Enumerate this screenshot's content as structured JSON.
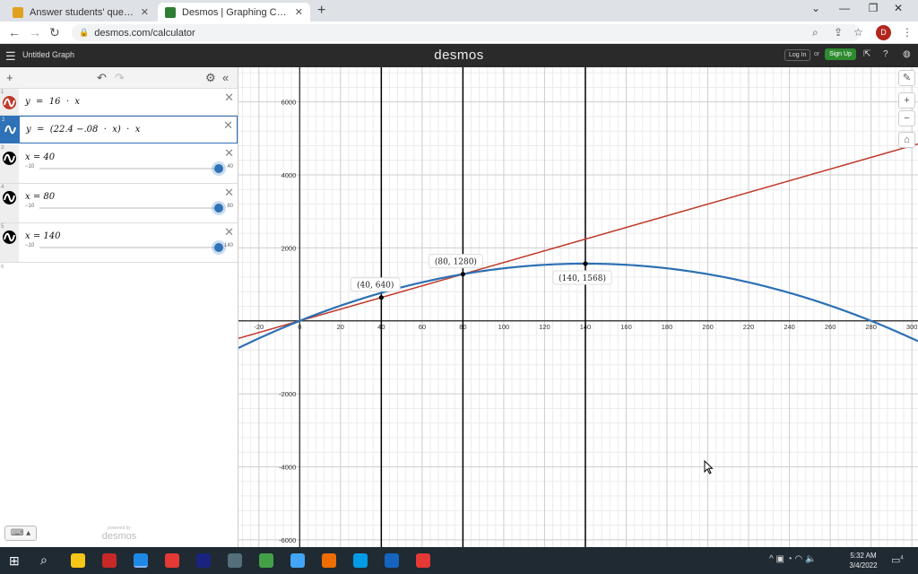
{
  "browser": {
    "tabs": [
      {
        "title": "Answer students' questions and",
        "favicon_color": "#e0a020"
      },
      {
        "title": "Desmos | Graphing Calculator",
        "favicon_color": "#2e7d32"
      }
    ],
    "new_tab": "+",
    "url": "desmos.com/calculator",
    "profile_initial": "D"
  },
  "header": {
    "title": "Untitled Graph",
    "logo": "desmos",
    "login": "Log In",
    "or": "or",
    "signup": "Sign Up"
  },
  "expressions": [
    {
      "index": "1",
      "latex": "y  =  16  ·  x",
      "color": "#c0392b"
    },
    {
      "index": "2",
      "latex": "y  =  (22.4 −.08  ·  x)  ·  x",
      "color": "#2d70b3"
    },
    {
      "index": "3",
      "latex": "x = 40",
      "color": "#000000",
      "slider": {
        "min": "−10",
        "max": "40",
        "value": 40,
        "min_value": -10,
        "max_value": 40
      }
    },
    {
      "index": "4",
      "latex": "x = 80",
      "color": "#000000",
      "slider": {
        "min": "−10",
        "max": "80",
        "value": 80,
        "min_value": -10,
        "max_value": 80
      }
    },
    {
      "index": "5",
      "latex": "x = 140",
      "color": "#000000",
      "slider": {
        "min": "−10",
        "max": "140",
        "value": 140,
        "min_value": -10,
        "max_value": 140
      }
    }
  ],
  "empty_row_index": "6",
  "powered_by": {
    "line1": "powered by",
    "line2": "desmos"
  },
  "chart_data": {
    "type": "line",
    "x_range": [
      -30,
      303
    ],
    "y_range": [
      -6200,
      6950
    ],
    "x_ticks": [
      -20,
      0,
      20,
      40,
      60,
      80,
      100,
      120,
      140,
      160,
      180,
      200,
      220,
      240,
      260,
      280,
      300
    ],
    "y_ticks": [
      6000,
      4000,
      2000,
      -2000,
      -4000,
      -6000
    ],
    "grid": true,
    "series": [
      {
        "expression": "y = 16x",
        "color": "#c0392b",
        "slope": 16
      },
      {
        "expression": "y = (22.4 - .08x)x",
        "color": "#2d70b3",
        "a": 22.4,
        "b": -0.08
      }
    ],
    "vertical_lines": [
      40,
      80,
      140
    ],
    "points": [
      {
        "x": 40,
        "y": 640,
        "label": "(40, 640)"
      },
      {
        "x": 80,
        "y": 1280,
        "label": "(80, 1280)"
      },
      {
        "x": 140,
        "y": 1568,
        "label": "(140, 1568)"
      }
    ]
  },
  "taskbar": {
    "time": "5:32 AM",
    "date": "3/4/2022",
    "notifications": "4",
    "app_colors": [
      "#f5c518",
      "#c62828",
      "#1e88e5",
      "#e53935",
      "#1a237e",
      "#546e7a",
      "#43a047",
      "#42a5f5",
      "#ef6c00",
      "#039be5",
      "#1565c0",
      "#e53935"
    ]
  }
}
